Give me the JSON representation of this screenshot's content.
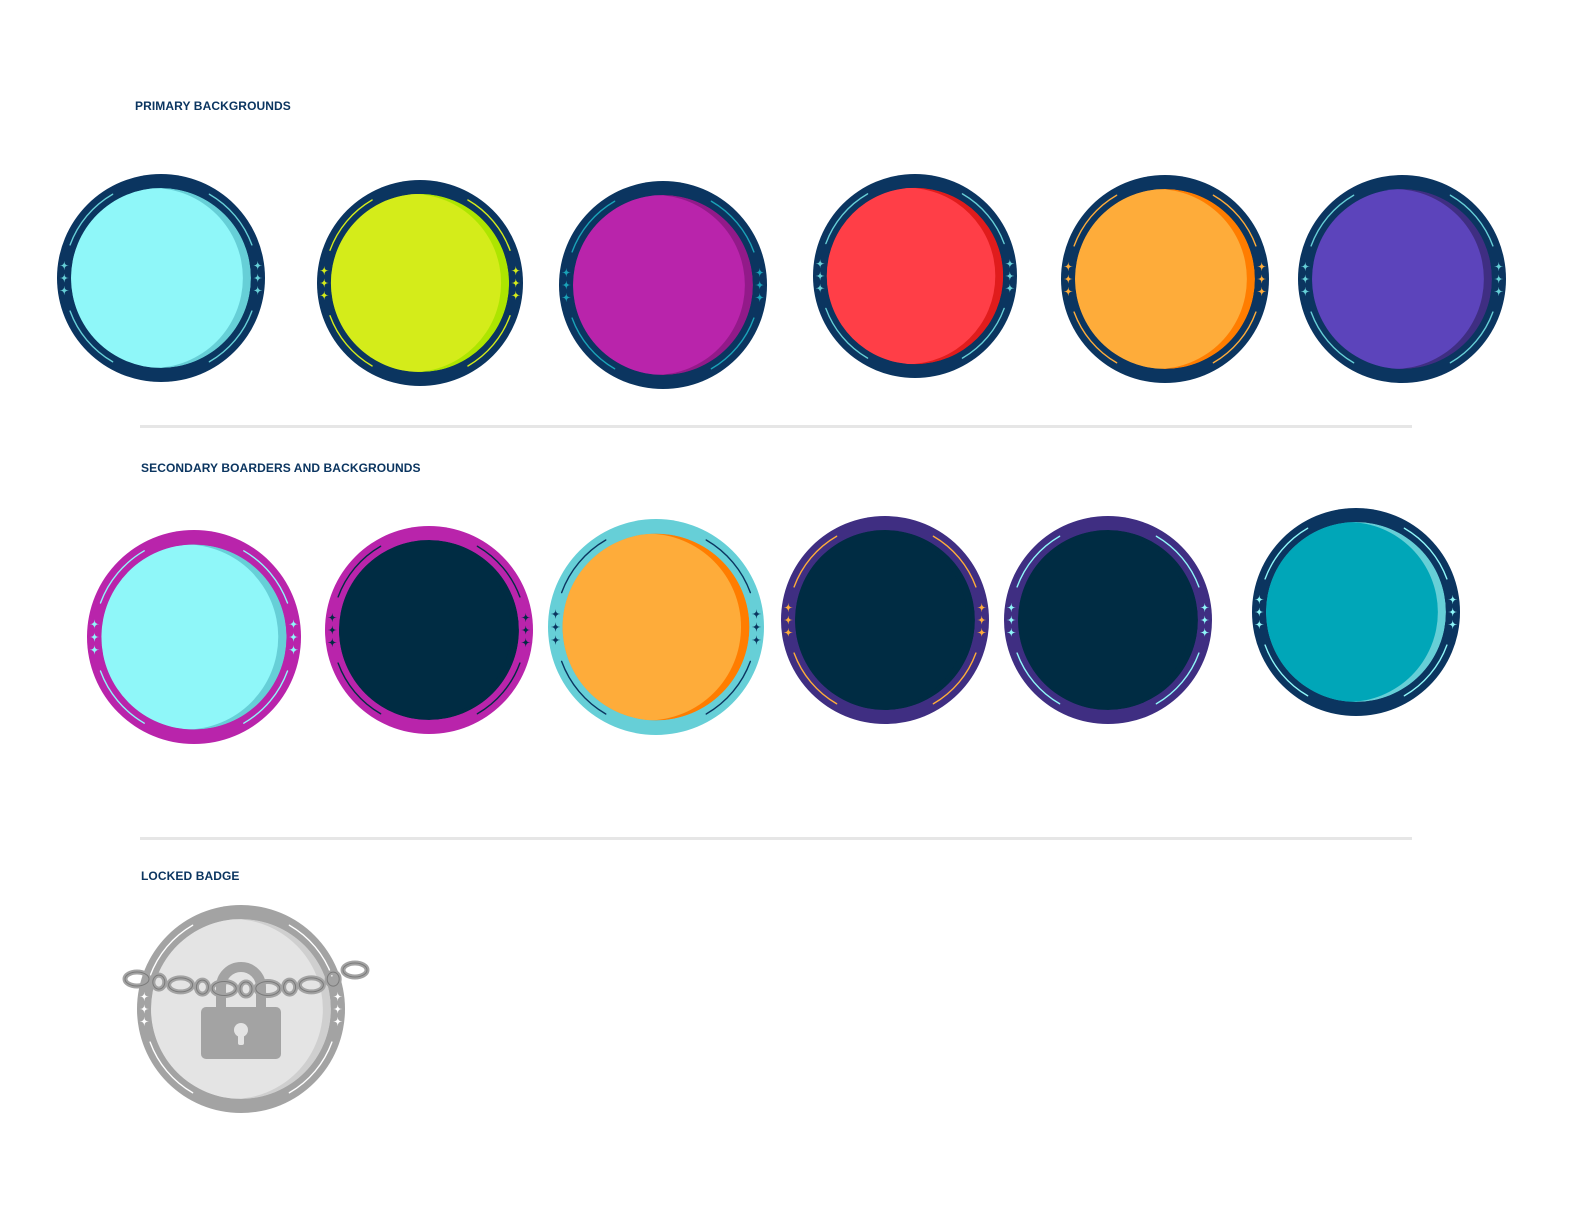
{
  "sections": {
    "primary_title": "PRIMARY BACKGROUNDS",
    "secondary_title": "SECONDARY BOARDERS AND BACKGROUNDS",
    "locked_title": "LOCKED BADGE"
  },
  "colors": {
    "title_text": "#0b3560",
    "divider": "#e6e6e6"
  },
  "primary_badges": [
    {
      "name": "badge-cyan",
      "border": "#0b3560",
      "fill": "#8ff7f9",
      "shade": "#66cfd7",
      "sparkle": "#66cfd7"
    },
    {
      "name": "badge-lime",
      "border": "#0b3560",
      "fill": "#d4ec1a",
      "shade": "#ade500",
      "sparkle": "#d4ec1a"
    },
    {
      "name": "badge-magenta",
      "border": "#0b3560",
      "fill": "#b924ab",
      "shade": "#921a89",
      "sparkle": "#1aa3b8"
    },
    {
      "name": "badge-red",
      "border": "#0b3560",
      "fill": "#ff3e47",
      "shade": "#e01c1c",
      "sparkle": "#66cfd7"
    },
    {
      "name": "badge-orange",
      "border": "#0b3560",
      "fill": "#feac3a",
      "shade": "#ff7d00",
      "sparkle": "#feac3a"
    },
    {
      "name": "badge-purple",
      "border": "#0b3560",
      "fill": "#5c44bb",
      "shade": "#3f2e82",
      "sparkle": "#66cfd7"
    }
  ],
  "secondary_badges": [
    {
      "name": "badge-magenta-border-cyan",
      "border": "#b924ab",
      "fill": "#8ff7f9",
      "shade": "#66cfd7",
      "sparkle": "#8ff7f9"
    },
    {
      "name": "badge-magenta-border-navy",
      "border": "#b924ab",
      "fill": "#002c43",
      "shade": "#002c43",
      "sparkle": "#002c43"
    },
    {
      "name": "badge-cyan-border-orange",
      "border": "#66cfd7",
      "fill": "#feac3a",
      "shade": "#ff7d00",
      "sparkle": "#0b3560"
    },
    {
      "name": "badge-purple-border-navy-orange",
      "border": "#3f2e82",
      "fill": "#002c43",
      "shade": "#002c43",
      "sparkle": "#feac3a"
    },
    {
      "name": "badge-purple-border-navy-cyan",
      "border": "#3f2e82",
      "fill": "#002c43",
      "shade": "#002c43",
      "sparkle": "#8ff7f9"
    },
    {
      "name": "badge-navy-border-teal",
      "border": "#0b3560",
      "fill": "#00a6b8",
      "shade": "#66cfd7",
      "sparkle": "#8ff7f9"
    }
  ],
  "locked_badge": {
    "name": "badge-locked",
    "border": "#a3a3a3",
    "fill": "#e4e4e4",
    "shade": "#cfcfcf",
    "sparkle": "#ffffff",
    "lock": "#a3a3a3",
    "keyhole": "#e4e4e4",
    "chain": "#a3a3a3",
    "chain_outline": "#7a7a7a"
  }
}
